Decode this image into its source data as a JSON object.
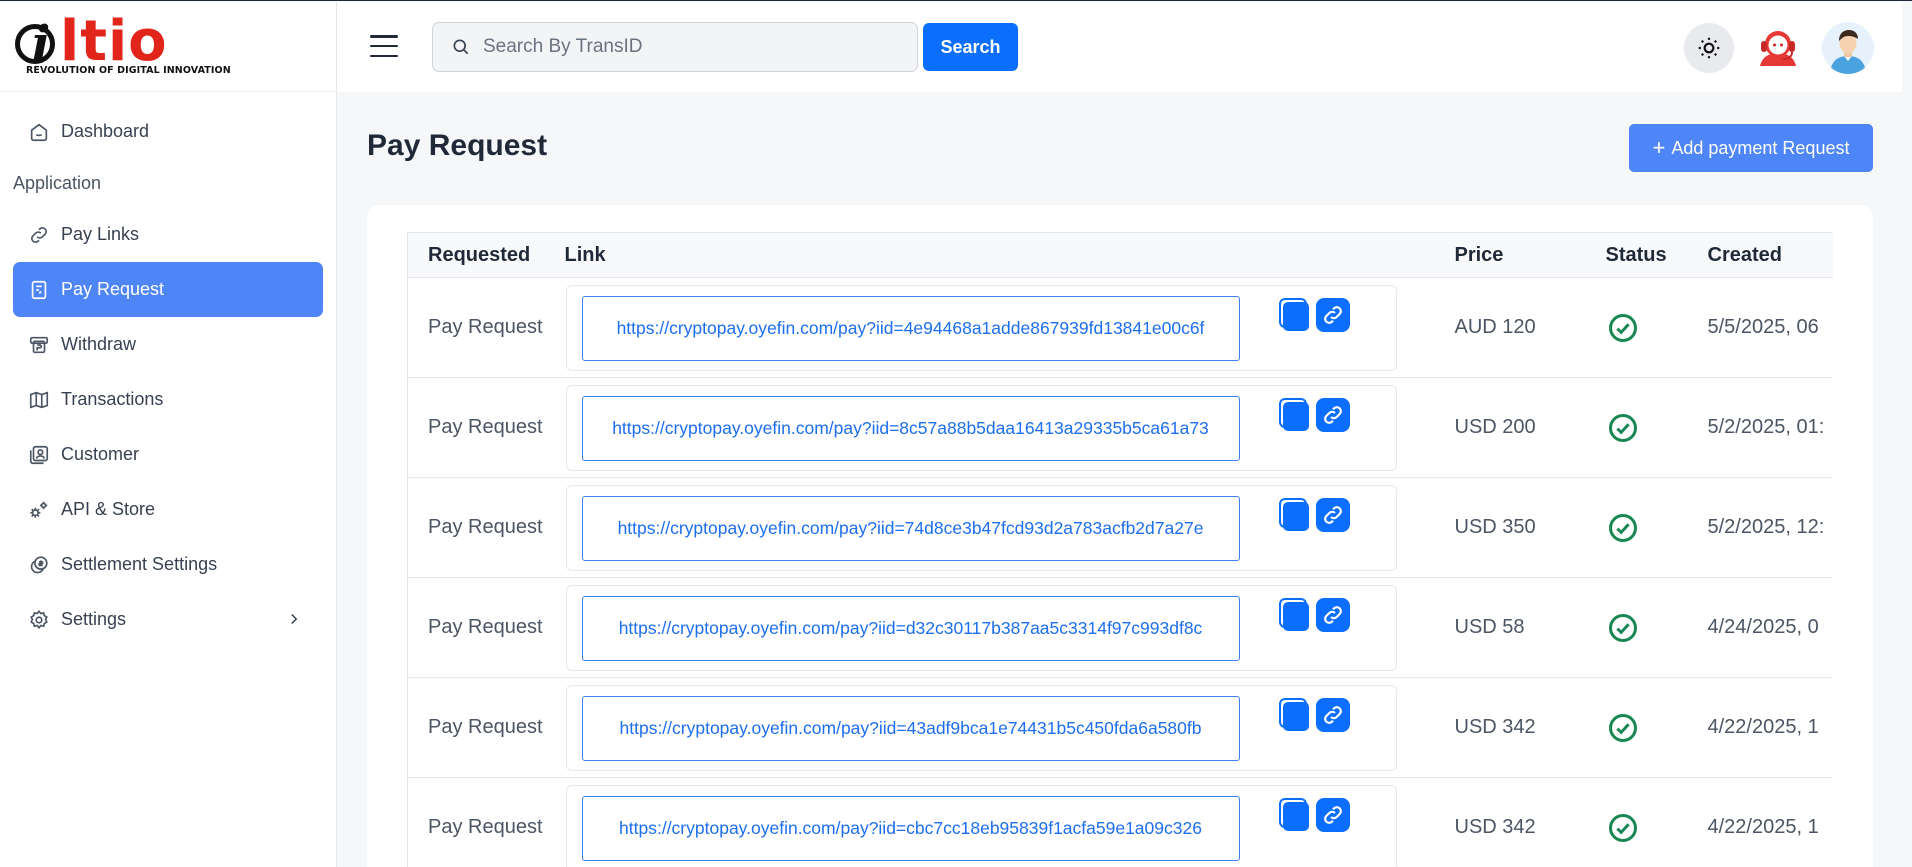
{
  "brand": {
    "logo_text": "ltio",
    "tagline": "REVOLUTION OF DIGITAL INNOVATION"
  },
  "sidebar": {
    "items": [
      {
        "label": "Dashboard",
        "icon": "dashboard-icon"
      },
      {
        "label": "Pay Links",
        "icon": "link-icon"
      },
      {
        "label": "Pay Request",
        "icon": "receipt-icon",
        "active": true
      },
      {
        "label": "Withdraw",
        "icon": "withdraw-icon"
      },
      {
        "label": "Transactions",
        "icon": "map-icon"
      },
      {
        "label": "Customer",
        "icon": "contacts-icon"
      },
      {
        "label": "API & Store",
        "icon": "gears-icon"
      },
      {
        "label": "Settlement Settings",
        "icon": "coins-icon"
      },
      {
        "label": "Settings",
        "icon": "gear-icon"
      }
    ],
    "section_label": "Application"
  },
  "header": {
    "search_placeholder": "Search By TransID",
    "search_value": "",
    "search_button": "Search"
  },
  "page": {
    "title": "Pay Request",
    "add_button": "Add payment Request"
  },
  "table": {
    "headers": {
      "requested": "Requested",
      "link": "Link",
      "price": "Price",
      "status": "Status",
      "created": "Created"
    },
    "rows": [
      {
        "requested": "Pay Request",
        "link": "https://cryptopay.oyefin.com/pay?iid=4e94468a1adde867939fd13841e00c6f",
        "price": "AUD 120",
        "status": "success",
        "created": "5/5/2025, 06"
      },
      {
        "requested": "Pay Request",
        "link": "https://cryptopay.oyefin.com/pay?iid=8c57a88b5daa16413a29335b5ca61a73",
        "price": "USD 200",
        "status": "success",
        "created": "5/2/2025, 01:"
      },
      {
        "requested": "Pay Request",
        "link": "https://cryptopay.oyefin.com/pay?iid=74d8ce3b47fcd93d2a783acfb2d7a27e",
        "price": "USD 350",
        "status": "success",
        "created": "5/2/2025, 12:"
      },
      {
        "requested": "Pay Request",
        "link": "https://cryptopay.oyefin.com/pay?iid=d32c30117b387aa5c3314f97c993df8c",
        "price": "USD 58",
        "status": "success",
        "created": "4/24/2025, 0"
      },
      {
        "requested": "Pay Request",
        "link": "https://cryptopay.oyefin.com/pay?iid=43adf9bca1e74431b5c450fda6a580fb",
        "price": "USD 342",
        "status": "success",
        "created": "4/22/2025, 1"
      },
      {
        "requested": "Pay Request",
        "link": "https://cryptopay.oyefin.com/pay?iid=cbc7cc18eb95839f1acfa59e1a09c326",
        "price": "USD 342",
        "status": "success",
        "created": "4/22/2025, 1"
      }
    ]
  },
  "colors": {
    "accent": "#4f86f7",
    "primary_button": "#0b6efd",
    "link": "#1d6ef0",
    "status_success": "#198754",
    "brand_red": "#e1251b"
  }
}
